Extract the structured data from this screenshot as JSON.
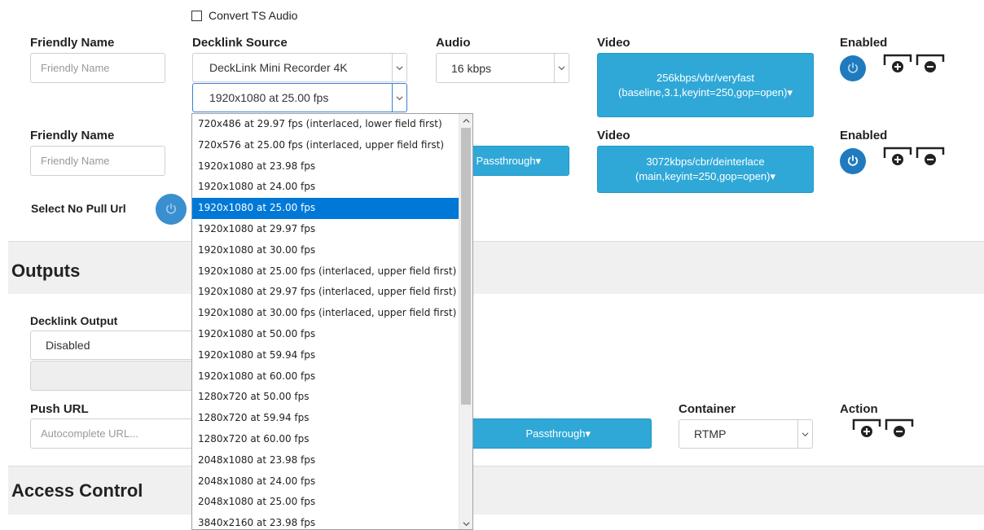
{
  "convert_ts_audio": {
    "label": "Convert TS Audio",
    "checked": false
  },
  "row1": {
    "friendly_name_label": "Friendly Name",
    "friendly_name_placeholder": "Friendly Name",
    "decklink_source_label": "Decklink Source",
    "decklink_source_value": "DeckLink Mini Recorder 4K",
    "format_value": "1920x1080 at 25.00 fps",
    "audio_label": "Audio",
    "audio_value": "16 kbps",
    "video_label": "Video",
    "video_button": "256kbps/vbr/veryfast (baseline,3.1,keyint=250,gop=open)▾",
    "enabled_label": "Enabled"
  },
  "row2": {
    "friendly_name_label": "Friendly Name",
    "friendly_name_placeholder": "Friendly Name",
    "audio_button": "Passthrough▾",
    "video_label": "Video",
    "video_button": "3072kbps/cbr/deinterlace (main,keyint=250,gop=open)▾",
    "enabled_label": "Enabled",
    "select_no_pull_url": "Select No Pull Url"
  },
  "outputs": {
    "title": "Outputs",
    "decklink_output_label": "Decklink Output",
    "decklink_output_value": "Disabled",
    "push_url_label": "Push URL",
    "push_url_placeholder": "Autocomplete URL...",
    "video_button": "Passthrough▾",
    "container_label": "Container",
    "container_value": "RTMP",
    "action_label": "Action"
  },
  "access_control": {
    "title": "Access Control"
  },
  "format_dropdown": {
    "selected_index": 4,
    "options": [
      "720x486 at 29.97 fps (interlaced, lower field first)",
      "720x576 at 25.00 fps (interlaced, upper field first)",
      "1920x1080 at 23.98 fps",
      "1920x1080 at 24.00 fps",
      "1920x1080 at 25.00 fps",
      "1920x1080 at 29.97 fps",
      "1920x1080 at 30.00 fps",
      "1920x1080 at 25.00 fps (interlaced, upper field first)",
      "1920x1080 at 29.97 fps (interlaced, upper field first)",
      "1920x1080 at 30.00 fps (interlaced, upper field first)",
      "1920x1080 at 50.00 fps",
      "1920x1080 at 59.94 fps",
      "1920x1080 at 60.00 fps",
      "1280x720 at 50.00 fps",
      "1280x720 at 59.94 fps",
      "1280x720 at 60.00 fps",
      "2048x1080 at 23.98 fps",
      "2048x1080 at 24.00 fps",
      "2048x1080 at 25.00 fps",
      "3840x2160 at 23.98 fps"
    ]
  },
  "colors": {
    "accent_blue": "#2fa8d8",
    "power_blue": "#1f7bbd",
    "selection": "#0078d7"
  }
}
